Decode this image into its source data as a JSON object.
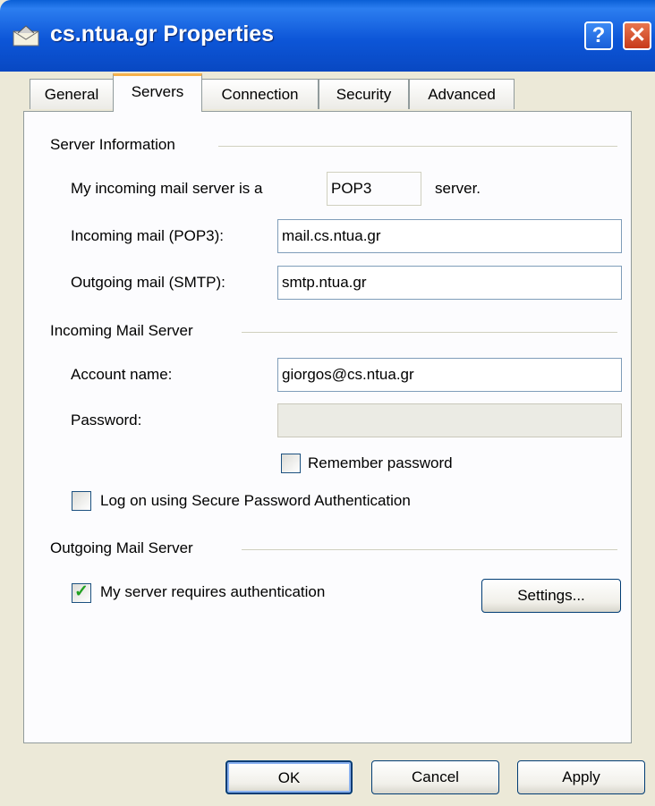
{
  "window": {
    "title": "cs.ntua.gr  Properties",
    "help_glyph": "?",
    "close_glyph": "✕"
  },
  "tabs": [
    {
      "label": "General"
    },
    {
      "label": "Servers"
    },
    {
      "label": "Connection"
    },
    {
      "label": "Security"
    },
    {
      "label": "Advanced"
    }
  ],
  "server_info": {
    "group_label": "Server Information",
    "incoming_type_prefix": "My incoming mail server is a",
    "incoming_type_value": "POP3",
    "incoming_type_suffix": "server.",
    "incoming_label": "Incoming mail (POP3):",
    "incoming_value": "mail.cs.ntua.gr",
    "outgoing_label": "Outgoing mail (SMTP):",
    "outgoing_value": "smtp.ntua.gr"
  },
  "incoming_server": {
    "group_label": "Incoming Mail Server",
    "account_label": "Account name:",
    "account_value": "giorgos@cs.ntua.gr",
    "password_label": "Password:",
    "password_value": "",
    "remember_label": "Remember password",
    "remember_checked": false,
    "spa_label": "Log on using Secure Password Authentication",
    "spa_checked": false
  },
  "outgoing_server": {
    "group_label": "Outgoing Mail Server",
    "auth_label": "My server requires authentication",
    "auth_checked": true,
    "settings_label": "Settings..."
  },
  "buttons": {
    "ok": "OK",
    "cancel": "Cancel",
    "apply": "Apply"
  },
  "colors": {
    "titlebar": "#0a5fd6",
    "dialog_bg": "#ece9d8",
    "panel_bg": "#fcfcfe",
    "active_tab_accent": "#f7b14a"
  }
}
